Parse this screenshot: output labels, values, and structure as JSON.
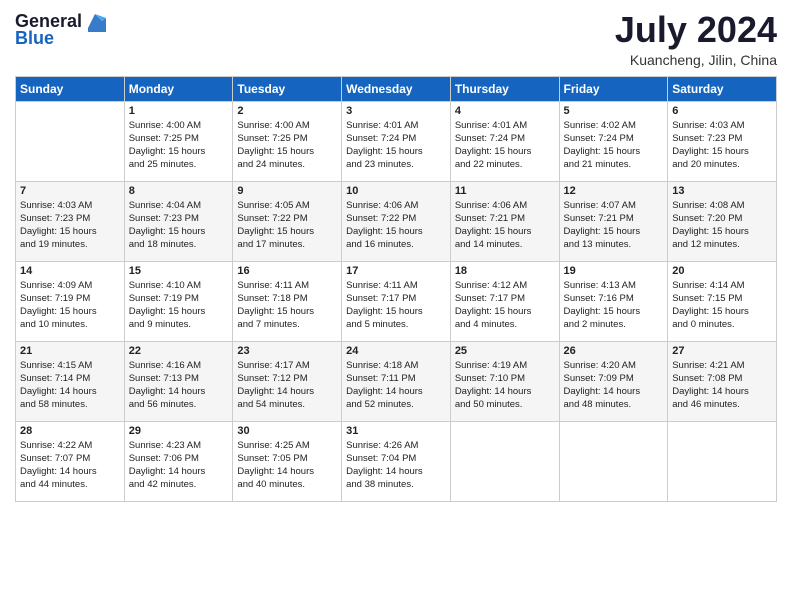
{
  "header": {
    "logo_general": "General",
    "logo_blue": "Blue",
    "month_year": "July 2024",
    "location": "Kuancheng, Jilin, China"
  },
  "days_header": [
    "Sunday",
    "Monday",
    "Tuesday",
    "Wednesday",
    "Thursday",
    "Friday",
    "Saturday"
  ],
  "weeks": [
    [
      {
        "day": "",
        "info": ""
      },
      {
        "day": "1",
        "info": "Sunrise: 4:00 AM\nSunset: 7:25 PM\nDaylight: 15 hours\nand 25 minutes."
      },
      {
        "day": "2",
        "info": "Sunrise: 4:00 AM\nSunset: 7:25 PM\nDaylight: 15 hours\nand 24 minutes."
      },
      {
        "day": "3",
        "info": "Sunrise: 4:01 AM\nSunset: 7:24 PM\nDaylight: 15 hours\nand 23 minutes."
      },
      {
        "day": "4",
        "info": "Sunrise: 4:01 AM\nSunset: 7:24 PM\nDaylight: 15 hours\nand 22 minutes."
      },
      {
        "day": "5",
        "info": "Sunrise: 4:02 AM\nSunset: 7:24 PM\nDaylight: 15 hours\nand 21 minutes."
      },
      {
        "day": "6",
        "info": "Sunrise: 4:03 AM\nSunset: 7:23 PM\nDaylight: 15 hours\nand 20 minutes."
      }
    ],
    [
      {
        "day": "7",
        "info": "Sunrise: 4:03 AM\nSunset: 7:23 PM\nDaylight: 15 hours\nand 19 minutes."
      },
      {
        "day": "8",
        "info": "Sunrise: 4:04 AM\nSunset: 7:23 PM\nDaylight: 15 hours\nand 18 minutes."
      },
      {
        "day": "9",
        "info": "Sunrise: 4:05 AM\nSunset: 7:22 PM\nDaylight: 15 hours\nand 17 minutes."
      },
      {
        "day": "10",
        "info": "Sunrise: 4:06 AM\nSunset: 7:22 PM\nDaylight: 15 hours\nand 16 minutes."
      },
      {
        "day": "11",
        "info": "Sunrise: 4:06 AM\nSunset: 7:21 PM\nDaylight: 15 hours\nand 14 minutes."
      },
      {
        "day": "12",
        "info": "Sunrise: 4:07 AM\nSunset: 7:21 PM\nDaylight: 15 hours\nand 13 minutes."
      },
      {
        "day": "13",
        "info": "Sunrise: 4:08 AM\nSunset: 7:20 PM\nDaylight: 15 hours\nand 12 minutes."
      }
    ],
    [
      {
        "day": "14",
        "info": "Sunrise: 4:09 AM\nSunset: 7:19 PM\nDaylight: 15 hours\nand 10 minutes."
      },
      {
        "day": "15",
        "info": "Sunrise: 4:10 AM\nSunset: 7:19 PM\nDaylight: 15 hours\nand 9 minutes."
      },
      {
        "day": "16",
        "info": "Sunrise: 4:11 AM\nSunset: 7:18 PM\nDaylight: 15 hours\nand 7 minutes."
      },
      {
        "day": "17",
        "info": "Sunrise: 4:11 AM\nSunset: 7:17 PM\nDaylight: 15 hours\nand 5 minutes."
      },
      {
        "day": "18",
        "info": "Sunrise: 4:12 AM\nSunset: 7:17 PM\nDaylight: 15 hours\nand 4 minutes."
      },
      {
        "day": "19",
        "info": "Sunrise: 4:13 AM\nSunset: 7:16 PM\nDaylight: 15 hours\nand 2 minutes."
      },
      {
        "day": "20",
        "info": "Sunrise: 4:14 AM\nSunset: 7:15 PM\nDaylight: 15 hours\nand 0 minutes."
      }
    ],
    [
      {
        "day": "21",
        "info": "Sunrise: 4:15 AM\nSunset: 7:14 PM\nDaylight: 14 hours\nand 58 minutes."
      },
      {
        "day": "22",
        "info": "Sunrise: 4:16 AM\nSunset: 7:13 PM\nDaylight: 14 hours\nand 56 minutes."
      },
      {
        "day": "23",
        "info": "Sunrise: 4:17 AM\nSunset: 7:12 PM\nDaylight: 14 hours\nand 54 minutes."
      },
      {
        "day": "24",
        "info": "Sunrise: 4:18 AM\nSunset: 7:11 PM\nDaylight: 14 hours\nand 52 minutes."
      },
      {
        "day": "25",
        "info": "Sunrise: 4:19 AM\nSunset: 7:10 PM\nDaylight: 14 hours\nand 50 minutes."
      },
      {
        "day": "26",
        "info": "Sunrise: 4:20 AM\nSunset: 7:09 PM\nDaylight: 14 hours\nand 48 minutes."
      },
      {
        "day": "27",
        "info": "Sunrise: 4:21 AM\nSunset: 7:08 PM\nDaylight: 14 hours\nand 46 minutes."
      }
    ],
    [
      {
        "day": "28",
        "info": "Sunrise: 4:22 AM\nSunset: 7:07 PM\nDaylight: 14 hours\nand 44 minutes."
      },
      {
        "day": "29",
        "info": "Sunrise: 4:23 AM\nSunset: 7:06 PM\nDaylight: 14 hours\nand 42 minutes."
      },
      {
        "day": "30",
        "info": "Sunrise: 4:25 AM\nSunset: 7:05 PM\nDaylight: 14 hours\nand 40 minutes."
      },
      {
        "day": "31",
        "info": "Sunrise: 4:26 AM\nSunset: 7:04 PM\nDaylight: 14 hours\nand 38 minutes."
      },
      {
        "day": "",
        "info": ""
      },
      {
        "day": "",
        "info": ""
      },
      {
        "day": "",
        "info": ""
      }
    ]
  ]
}
